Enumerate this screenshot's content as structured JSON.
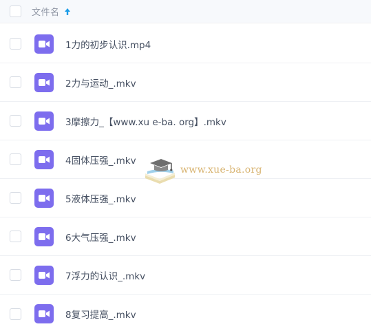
{
  "header": {
    "column_label": "文件名",
    "sort_icon": "arrow-up-icon",
    "sort_color": "#1a9ce8"
  },
  "files": [
    {
      "name": "1力的初步认识.mp4",
      "icon": "video-file-icon"
    },
    {
      "name": "2力与运动_.mkv",
      "icon": "video-file-icon"
    },
    {
      "name": "3摩擦力_【www.xu e-ba. org】.mkv",
      "icon": "video-file-icon"
    },
    {
      "name": "4固体压强_.mkv",
      "icon": "video-file-icon"
    },
    {
      "name": "5液体压强_.mkv",
      "icon": "video-file-icon"
    },
    {
      "name": "6大气压强_.mkv",
      "icon": "video-file-icon"
    },
    {
      "name": "7浮力的认识_.mkv",
      "icon": "video-file-icon"
    },
    {
      "name": "8复习提高_.mkv",
      "icon": "video-file-icon"
    }
  ],
  "watermark": {
    "text": "www.xue-ba.org",
    "icon": "graduation-cap-book-icon"
  },
  "colors": {
    "video_icon_bg": "#7d6dee",
    "header_bg": "#f7f9fc",
    "watermark_text": "#d2a85a"
  }
}
